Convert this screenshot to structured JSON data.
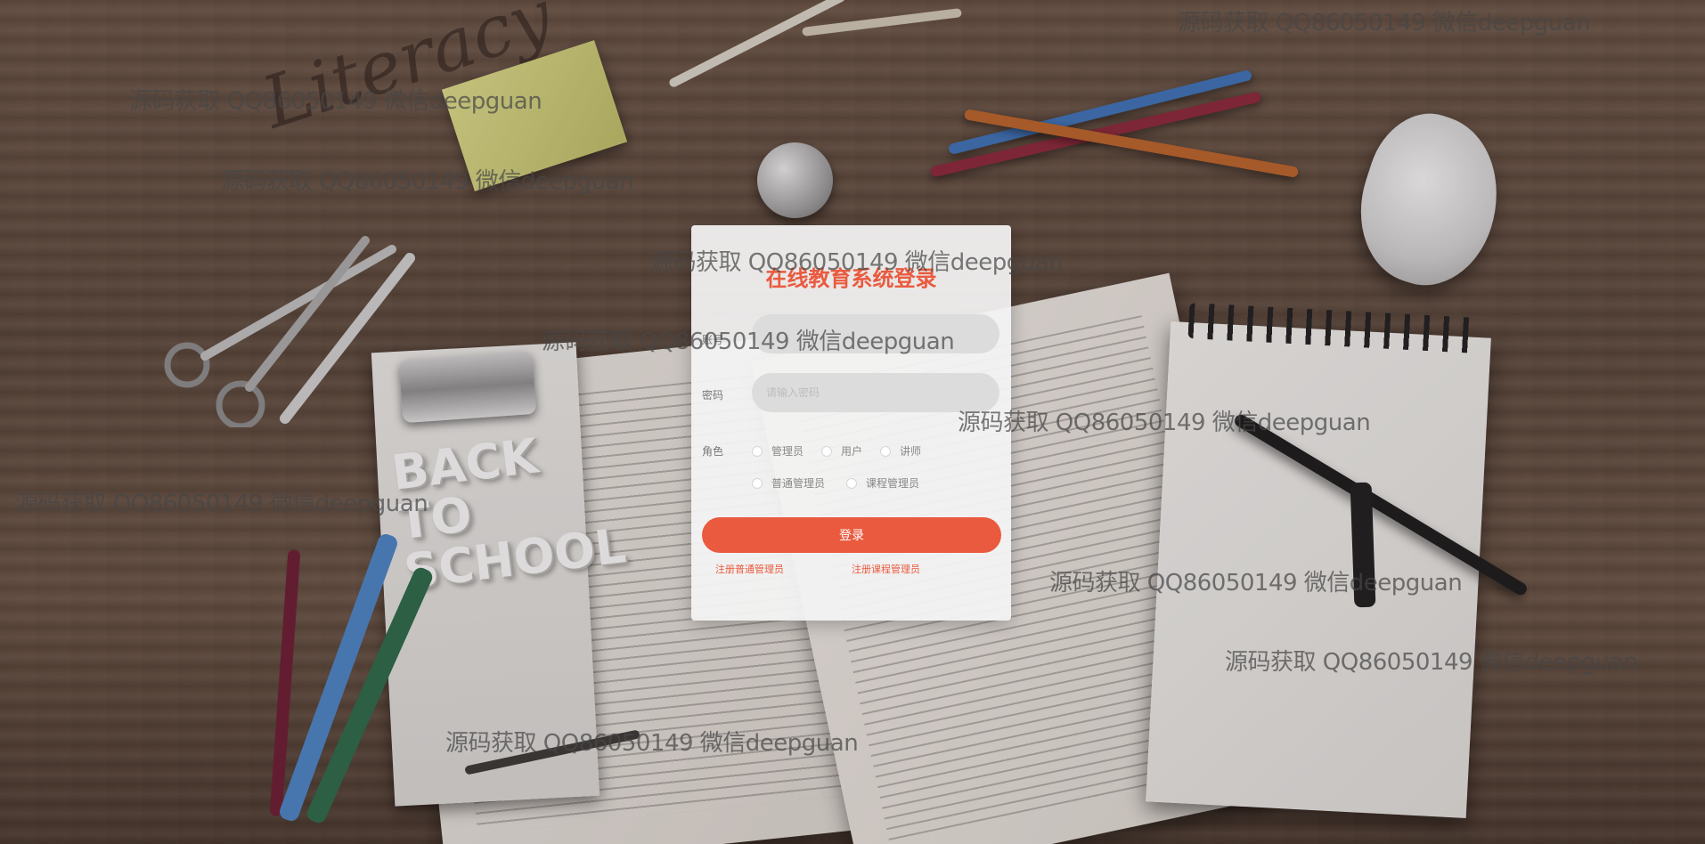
{
  "login": {
    "title": "在线教育系统登录",
    "username_label": "账号",
    "username_placeholder": "",
    "password_label": "密码",
    "password_placeholder": "请输入密码",
    "role_label": "角色",
    "roles": [
      "管理员",
      "用户",
      "讲师",
      "普通管理员",
      "课程管理员"
    ],
    "login_button": "登录",
    "register_general_admin": "注册普通管理员",
    "register_course_admin": "注册课程管理员"
  },
  "background": {
    "notebook_card_text": "BACK TO SCHOOL"
  },
  "watermark_text": "源码获取 QQ86050149 微信deepguan",
  "colors": {
    "accent": "#ea5a3f",
    "panel_bg": "#f4f4f4",
    "input_bg": "#dcdcdc"
  }
}
